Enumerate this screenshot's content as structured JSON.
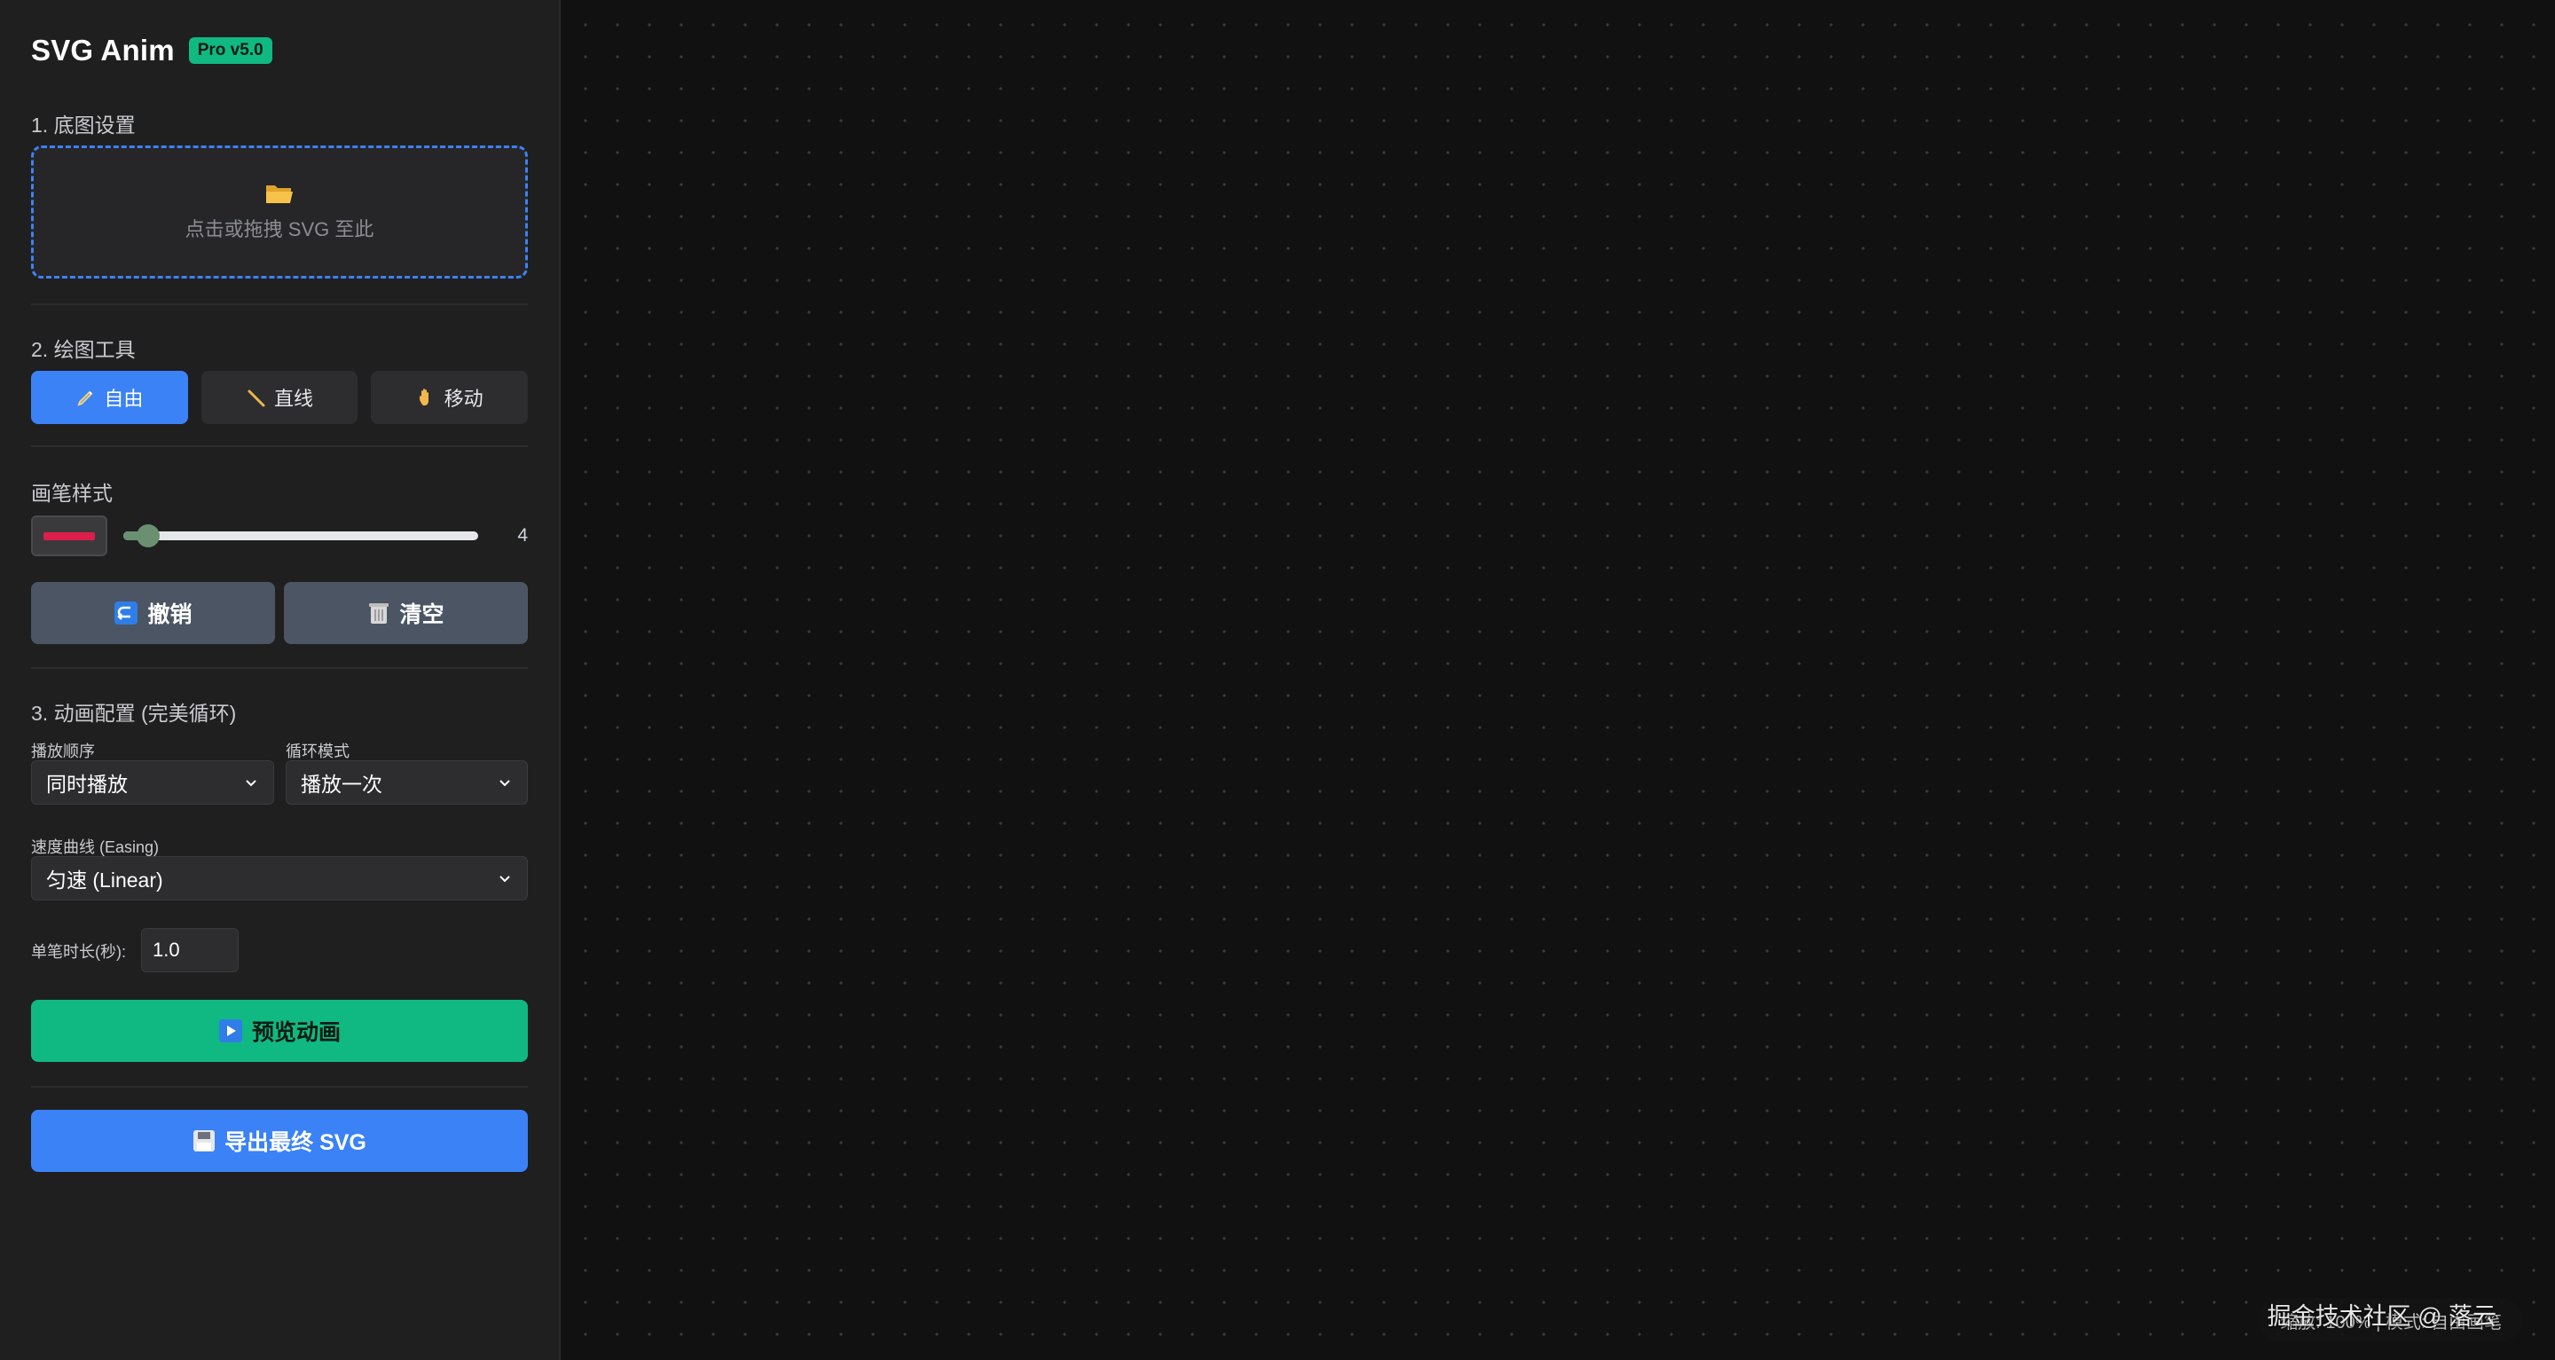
{
  "brand": {
    "title": "SVG Anim",
    "badge": "Pro v5.0"
  },
  "sections": {
    "base_image": "1. 底图设置",
    "draw_tools": "2. 绘图工具",
    "brush_style": "画笔样式",
    "animation": "3. 动画配置 (完美循环)"
  },
  "dropzone": {
    "icon": "folder-open-icon",
    "hint": "点击或拖拽 SVG 至此"
  },
  "tools": [
    {
      "label": "自由",
      "icon": "pencil-icon",
      "active": true
    },
    {
      "label": "直线",
      "icon": "ruler-line-icon",
      "active": false
    },
    {
      "label": "移动",
      "icon": "hand-icon",
      "active": false
    }
  ],
  "brush": {
    "color": "#dc1e4b",
    "size": "4",
    "size_fraction": 0.07
  },
  "actions": {
    "undo": "撤销",
    "clear": "清空"
  },
  "animation": {
    "order_label": "播放顺序",
    "order_value": "同时播放",
    "loop_label": "循环模式",
    "loop_value": "播放一次",
    "easing_label": "速度曲线 (Easing)",
    "easing_value": "匀速 (Linear)",
    "duration_label": "单笔时长(秒):",
    "duration_value": "1.0"
  },
  "buttons": {
    "preview": "预览动画",
    "export": "导出最终 SVG"
  },
  "status": {
    "text": "缩放: 100% | 模式: 自由画笔"
  },
  "watermark": "掘金技术社区 @ 落云",
  "colors": {
    "accent_blue": "#3b82f6",
    "accent_green": "#10b981",
    "sidebar_bg": "#1f1f20",
    "canvas_bg": "#111111"
  }
}
